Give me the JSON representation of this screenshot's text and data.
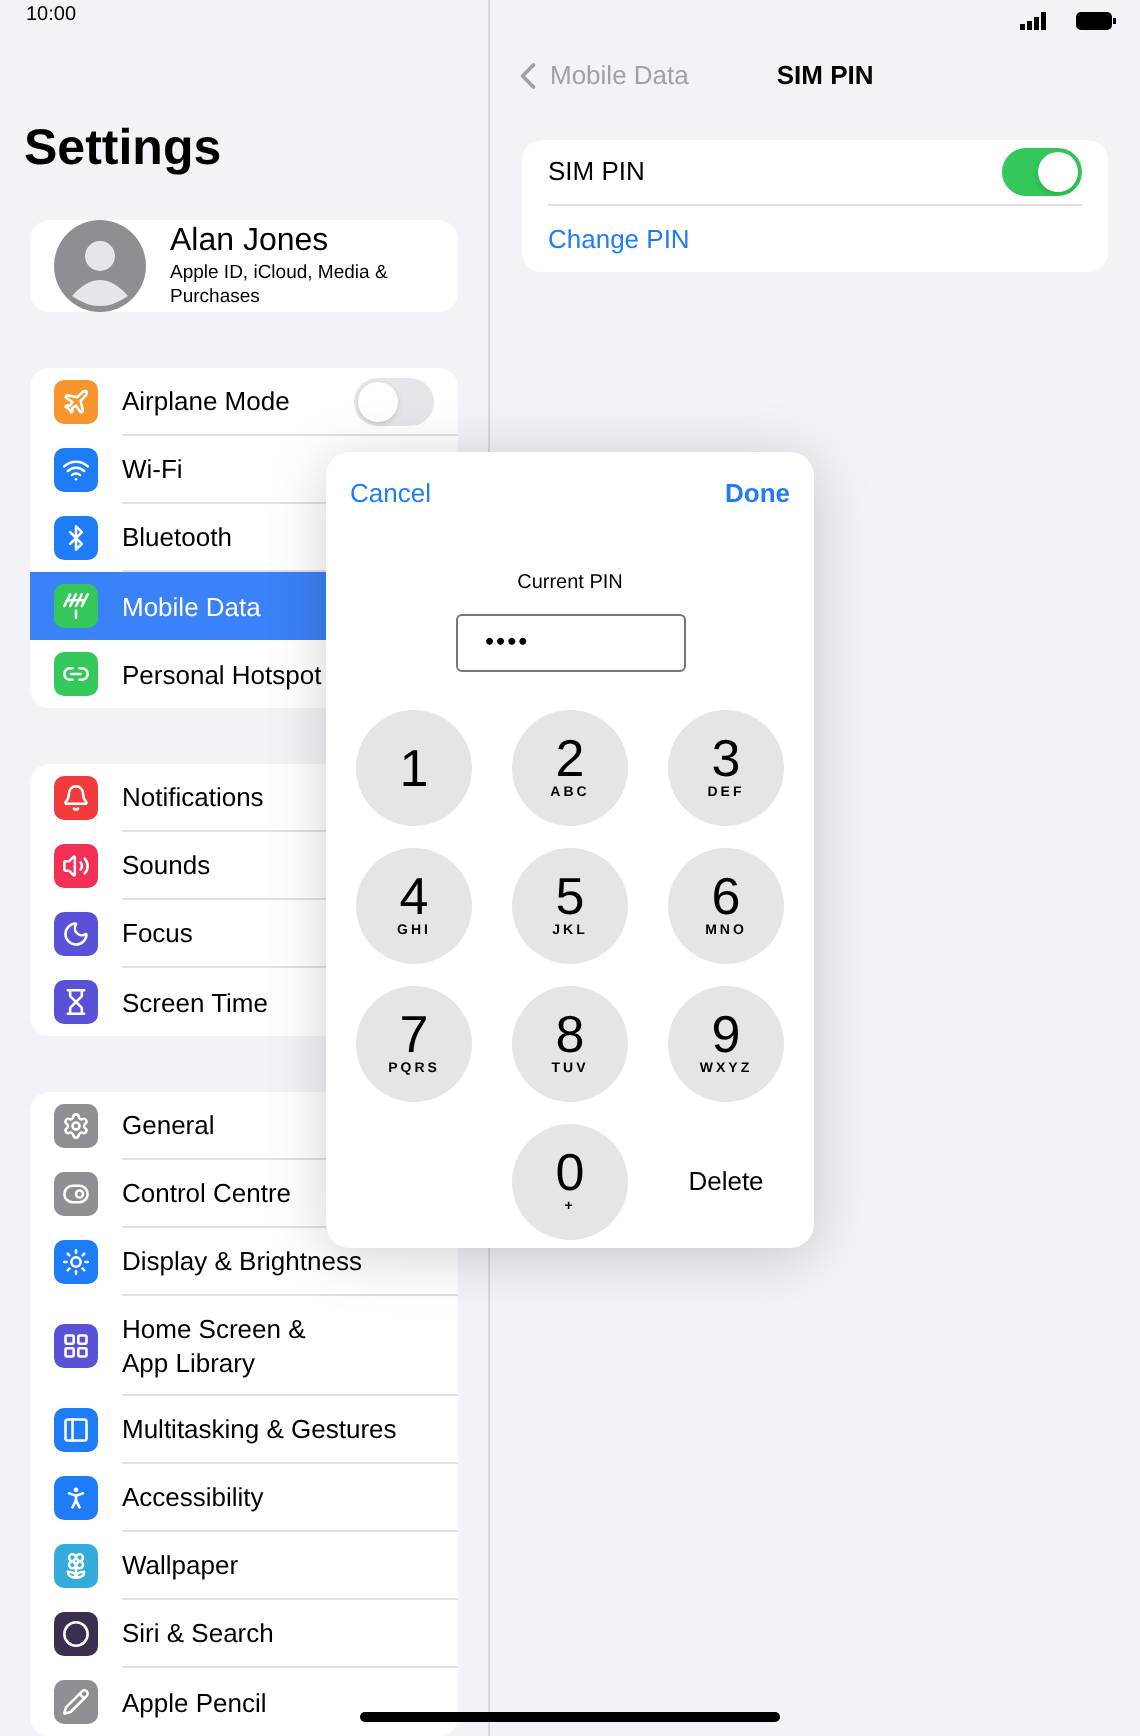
{
  "status_bar": {
    "time": "10:00"
  },
  "sidebar": {
    "title": "Settings",
    "profile": {
      "name": "Alan Jones",
      "subtitle": "Apple ID, iCloud, Media & Purchases"
    },
    "groups": [
      [
        {
          "label": "Airplane Mode",
          "color": "#f7952e",
          "kind": "toggle",
          "on": false,
          "selected": false
        },
        {
          "label": "Wi-Fi",
          "color": "#1e7cf6",
          "kind": "plain",
          "selected": false
        },
        {
          "label": "Bluetooth",
          "color": "#1e7cf6",
          "kind": "plain",
          "selected": false
        },
        {
          "label": "Mobile Data",
          "color": "#34c759",
          "kind": "plain",
          "selected": true
        },
        {
          "label": "Personal Hotspot",
          "color": "#34c759",
          "kind": "plain",
          "selected": false
        }
      ],
      [
        {
          "label": "Notifications",
          "color": "#f23b3b",
          "kind": "plain",
          "selected": false
        },
        {
          "label": "Sounds",
          "color": "#f22f55",
          "kind": "plain",
          "selected": false
        },
        {
          "label": "Focus",
          "color": "#5a52d6",
          "kind": "plain",
          "selected": false
        },
        {
          "label": "Screen Time",
          "color": "#5a52d6",
          "kind": "plain",
          "selected": false
        }
      ],
      [
        {
          "label": "General",
          "color": "#8e8e93",
          "kind": "plain",
          "selected": false
        },
        {
          "label": "Control Centre",
          "color": "#8e8e93",
          "kind": "plain",
          "selected": false
        },
        {
          "label": "Display & Brightness",
          "color": "#1e7cf6",
          "kind": "plain",
          "selected": false
        },
        {
          "label": "Home Screen & App Library",
          "color": "#5a52d6",
          "kind": "plain",
          "selected": false
        },
        {
          "label": "Multitasking & Gestures",
          "color": "#1e7cf6",
          "kind": "plain",
          "selected": false
        },
        {
          "label": "Accessibility",
          "color": "#1e7cf6",
          "kind": "plain",
          "selected": false
        },
        {
          "label": "Wallpaper",
          "color": "#35aadc",
          "kind": "plain",
          "selected": false
        },
        {
          "label": "Siri & Search",
          "color": "#3a2f4f",
          "kind": "plain",
          "selected": false
        },
        {
          "label": "Apple Pencil",
          "color": "#8e8e93",
          "kind": "plain",
          "selected": false
        }
      ]
    ]
  },
  "detail": {
    "back": "Mobile Data",
    "title": "SIM PIN",
    "rows": [
      {
        "label": "SIM PIN",
        "kind": "toggle",
        "on": true
      },
      {
        "label": "Change PIN",
        "kind": "link"
      }
    ]
  },
  "pin_dialog": {
    "cancel": "Cancel",
    "done": "Done",
    "field_label": "Current PIN",
    "value": "••••",
    "keys": [
      {
        "digit": "1"
      },
      {
        "digit": "2",
        "letters": "ABC"
      },
      {
        "digit": "3",
        "letters": "DEF"
      },
      {
        "digit": "4",
        "letters": "GHI"
      },
      {
        "digit": "5",
        "letters": "JKL"
      },
      {
        "digit": "6",
        "letters": "MNO"
      },
      {
        "digit": "7",
        "letters": "PQRS"
      },
      {
        "digit": "8",
        "letters": "TUV"
      },
      {
        "digit": "9",
        "letters": "WXYZ"
      },
      {
        "digit": "0",
        "letters": "+"
      }
    ],
    "delete": "Delete"
  }
}
